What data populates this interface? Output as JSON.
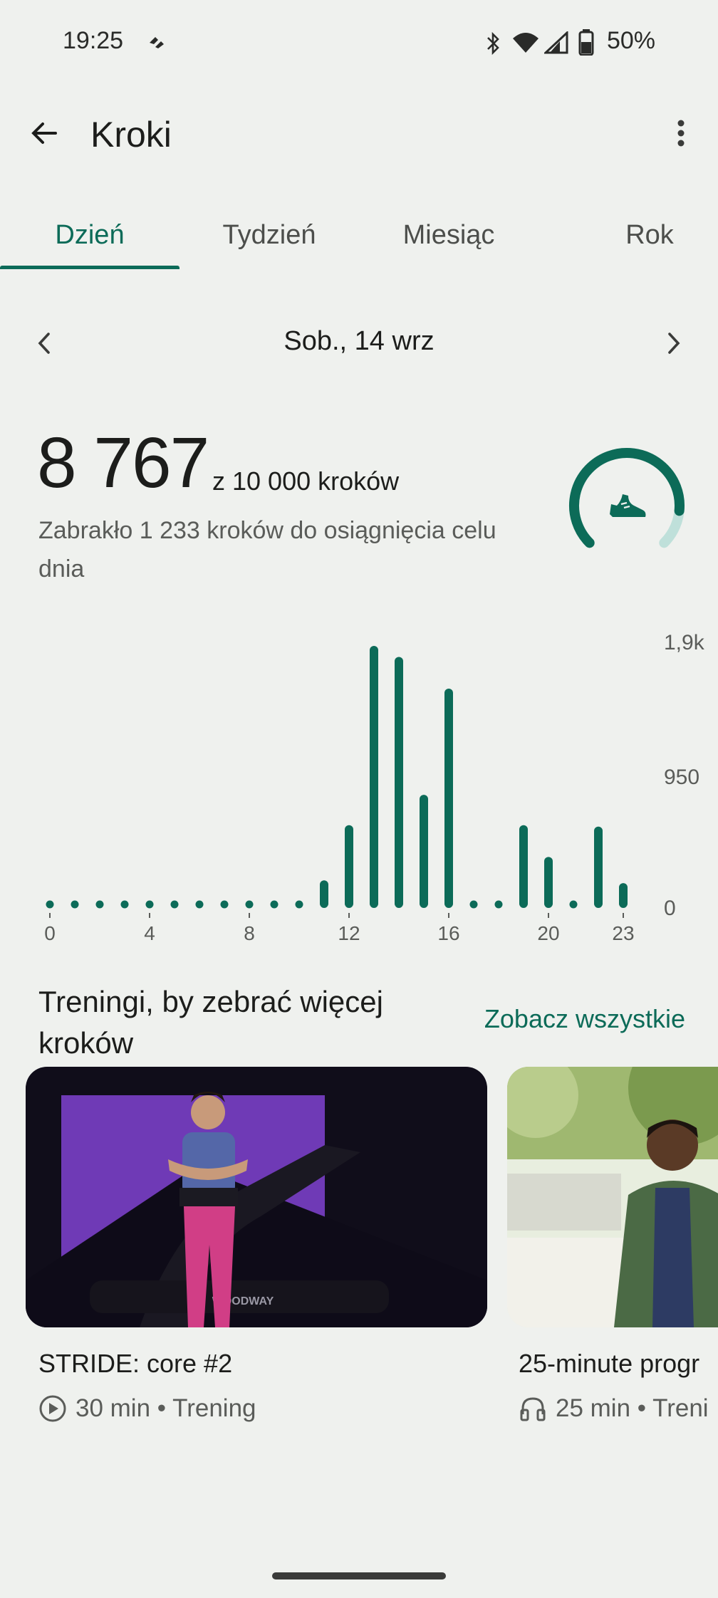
{
  "status_bar": {
    "time": "19:25",
    "battery": "50%"
  },
  "header": {
    "title": "Kroki"
  },
  "tabs": [
    {
      "label": "Dzień",
      "active": true
    },
    {
      "label": "Tydzień",
      "active": false
    },
    {
      "label": "Miesiąc",
      "active": false
    },
    {
      "label": "Rok",
      "active": false
    }
  ],
  "date_nav": {
    "label": "Sob., 14 wrz"
  },
  "summary": {
    "steps": "8 767",
    "goal_text": "z 10 000 kroków",
    "remaining_text": "Zabrakło 1 233 kroków do osiągnięcia celu dnia",
    "progress": 0.8767
  },
  "chart_data": {
    "type": "bar",
    "categories": [
      "0",
      "1",
      "2",
      "3",
      "4",
      "5",
      "6",
      "7",
      "8",
      "9",
      "10",
      "11",
      "12",
      "13",
      "14",
      "15",
      "16",
      "17",
      "18",
      "19",
      "20",
      "21",
      "22",
      "23"
    ],
    "values": [
      0,
      0,
      0,
      0,
      0,
      0,
      0,
      0,
      0,
      0,
      0,
      200,
      600,
      1900,
      1820,
      820,
      1590,
      0,
      0,
      600,
      370,
      0,
      590,
      180
    ],
    "x_tick_labels": [
      "0",
      "4",
      "8",
      "12",
      "16",
      "20",
      "23"
    ],
    "y_tick_labels": [
      "1,9k",
      "950",
      "0"
    ],
    "ylim": [
      0,
      1900
    ],
    "color": "#0c6b58"
  },
  "section": {
    "title": "Treningi, by zebrać więcej kroków",
    "see_all": "Zobacz wszystkie"
  },
  "workouts": [
    {
      "title": "STRIDE: core #2",
      "meta": "30 min • Trening",
      "icon": "play-circle-icon",
      "brand_text": "WOODWAY"
    },
    {
      "title": "25-minute progr",
      "meta": "25 min • Treni",
      "icon": "headphones-icon"
    }
  ],
  "colors": {
    "accent": "#0c6b58",
    "accent_light": "#bfe0da",
    "background": "#eff1ee"
  }
}
